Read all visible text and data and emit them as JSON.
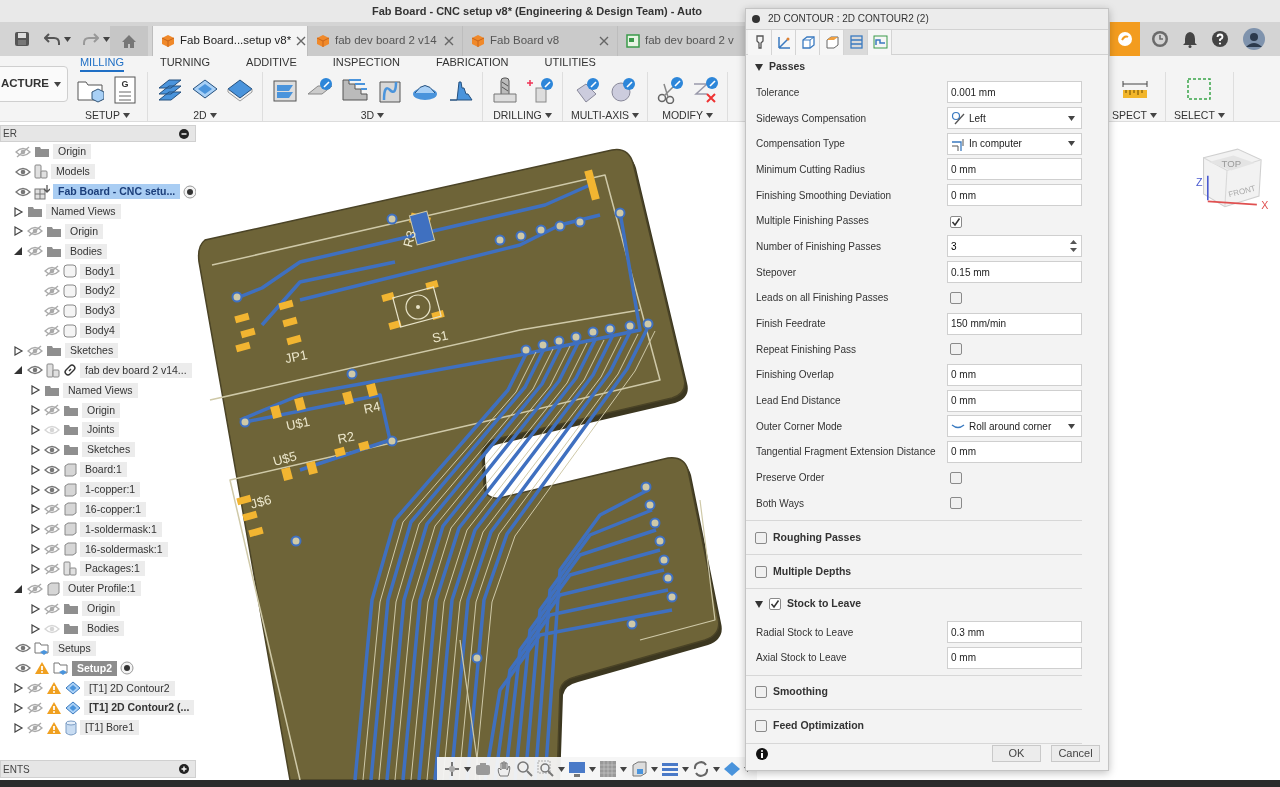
{
  "window": {
    "title": "Fab Board - CNC setup v8* (Engineering & Design Team) - Auto"
  },
  "document_tabs": [
    {
      "label": "Fab Board...setup v8*",
      "kind": "part",
      "selected": true
    },
    {
      "label": "fab dev board 2 v14",
      "kind": "part",
      "selected": false
    },
    {
      "label": "Fab Board v8",
      "kind": "part",
      "selected": false
    },
    {
      "label": "fab dev board 2 v",
      "kind": "drawing",
      "selected": false
    }
  ],
  "ribbon": {
    "workspace": "ACTURE",
    "tabs": [
      {
        "label": "MILLING",
        "selected": true
      },
      {
        "label": "TURNING",
        "selected": false
      },
      {
        "label": "ADDITIVE",
        "selected": false
      },
      {
        "label": "INSPECTION",
        "selected": false
      },
      {
        "label": "FABRICATION",
        "selected": false
      },
      {
        "label": "UTILITIES",
        "selected": false
      }
    ],
    "groups": [
      {
        "label": "SETUP",
        "icon_letter": "G"
      },
      {
        "label": "2D"
      },
      {
        "label": "3D"
      },
      {
        "label": "DRILLING"
      },
      {
        "label": "MULTI-AXIS"
      },
      {
        "label": "MODIFY"
      },
      {
        "label": "SPECT"
      },
      {
        "label": "SELECT"
      }
    ]
  },
  "browser": {
    "title": "ER",
    "tree": [
      {
        "label": "Origin",
        "visible": false,
        "kind": "folder",
        "selected": false
      },
      {
        "label": "Models",
        "visible": true,
        "kind": "component",
        "selected": false,
        "children": [
          {
            "label": "Fab Board - CNC setu...",
            "visible": true,
            "kind": "model",
            "selected": true,
            "bold": true,
            "radio": true,
            "children": [
              {
                "label": "Named Views",
                "kind": "folder",
                "expanded": false,
                "selected": false
              },
              {
                "label": "Origin",
                "visible": false,
                "kind": "folder",
                "expanded": false,
                "selected": false
              },
              {
                "label": "Bodies",
                "visible": false,
                "kind": "folder",
                "expanded": true,
                "selected": false,
                "children": [
                  {
                    "label": "Body1",
                    "visible": false,
                    "kind": "body",
                    "selected": false
                  },
                  {
                    "label": "Body2",
                    "visible": false,
                    "kind": "body",
                    "selected": false
                  },
                  {
                    "label": "Body3",
                    "visible": false,
                    "kind": "body",
                    "selected": false
                  },
                  {
                    "label": "Body4",
                    "visible": false,
                    "kind": "body",
                    "selected": false
                  }
                ]
              },
              {
                "label": "Sketches",
                "visible": false,
                "kind": "folder",
                "expanded": false,
                "selected": false
              },
              {
                "label": "fab dev board 2 v14...",
                "visible": true,
                "kind": "component",
                "link": true,
                "expanded": true,
                "selected": false,
                "children": [
                  {
                    "label": "Named Views",
                    "kind": "folder",
                    "expanded": false,
                    "selected": false
                  },
                  {
                    "label": "Origin",
                    "visible": false,
                    "kind": "folder",
                    "expanded": false,
                    "selected": false
                  },
                  {
                    "label": "Joints",
                    "visible": true,
                    "dimmed": true,
                    "kind": "folder",
                    "expanded": false,
                    "selected": false
                  },
                  {
                    "label": "Sketches",
                    "visible": true,
                    "kind": "folder",
                    "expanded": false,
                    "selected": false
                  },
                  {
                    "label": "Board:1",
                    "visible": true,
                    "kind": "solid",
                    "expanded": false,
                    "selected": false
                  },
                  {
                    "label": "1-copper:1",
                    "visible": true,
                    "kind": "solid",
                    "expanded": false,
                    "selected": false
                  },
                  {
                    "label": "16-copper:1",
                    "visible": false,
                    "kind": "solid",
                    "expanded": false,
                    "selected": false
                  },
                  {
                    "label": "1-soldermask:1",
                    "visible": false,
                    "kind": "solid",
                    "expanded": false,
                    "selected": false
                  },
                  {
                    "label": "16-soldermask:1",
                    "visible": false,
                    "kind": "solid",
                    "expanded": false,
                    "selected": false
                  },
                  {
                    "label": "Packages:1",
                    "visible": false,
                    "kind": "component",
                    "expanded": false,
                    "selected": false
                  }
                ]
              },
              {
                "label": "Outer Profile:1",
                "visible": false,
                "kind": "solid",
                "expanded": true,
                "selected": false,
                "children": [
                  {
                    "label": "Origin",
                    "visible": false,
                    "kind": "folder",
                    "expanded": false,
                    "selected": false
                  },
                  {
                    "label": "Bodies",
                    "visible": true,
                    "dimmed": true,
                    "kind": "folder",
                    "expanded": false,
                    "selected": false
                  }
                ]
              }
            ]
          }
        ]
      },
      {
        "label": "Setups",
        "visible": true,
        "kind": "setup",
        "selected": false,
        "children": [
          {
            "label": "Setup2",
            "visible": true,
            "warning": true,
            "kind": "setup",
            "active": true,
            "selected": false,
            "bold": true,
            "radio": true,
            "children": [
              {
                "label": "[T1] 2D Contour2",
                "visible": false,
                "warning": true,
                "kind": "contour",
                "expanded": false,
                "selected": false
              },
              {
                "label": "[T1] 2D Contour2 (...",
                "visible": false,
                "warning": true,
                "kind": "contour",
                "bold": true,
                "expanded": false,
                "selected": false
              },
              {
                "label": "[T1] Bore1",
                "visible": false,
                "warning": true,
                "kind": "bore",
                "expanded": false,
                "selected": false
              }
            ]
          }
        ]
      }
    ]
  },
  "comments": {
    "title": "ENTS"
  },
  "viewport": {
    "board_labels": [
      "R3",
      "JP1",
      "S1",
      "U$1",
      "R4",
      "R2",
      "U$5",
      "J$6"
    ],
    "view_cube": {
      "top": "TOP",
      "front": "FRONT",
      "axes": [
        "Z",
        "X"
      ]
    }
  },
  "dialog": {
    "title": "2D CONTOUR : 2D CONTOUR2 (2)",
    "tabs": [
      {
        "selected": false
      },
      {
        "selected": false
      },
      {
        "selected": false
      },
      {
        "selected": false
      },
      {
        "selected": true
      },
      {
        "selected": false
      }
    ],
    "sections": [
      {
        "title": "Passes",
        "expanded": true,
        "rows": [
          {
            "label": "Tolerance",
            "kind": "text",
            "value": "0.001 mm"
          },
          {
            "label": "Sideways Compensation",
            "kind": "dropdown",
            "value": "Left"
          },
          {
            "label": "Compensation Type",
            "kind": "dropdown",
            "value": "In computer"
          },
          {
            "label": "Minimum Cutting Radius",
            "kind": "text",
            "value": "0 mm"
          },
          {
            "label": "Finishing Smoothing Deviation",
            "kind": "text",
            "value": "0 mm"
          },
          {
            "label": "Multiple Finishing Passes",
            "kind": "checkbox",
            "checked": true
          },
          {
            "label": "Number of Finishing Passes",
            "kind": "spinner",
            "value": "3"
          },
          {
            "label": "Stepover",
            "kind": "text",
            "value": "0.15 mm"
          },
          {
            "label": "Leads on all Finishing Passes",
            "kind": "checkbox",
            "checked": false
          },
          {
            "label": "Finish Feedrate",
            "kind": "text",
            "value": "150 mm/min"
          },
          {
            "label": "Repeat Finishing Pass",
            "kind": "checkbox",
            "checked": false
          },
          {
            "label": "Finishing Overlap",
            "kind": "text",
            "value": "0 mm"
          },
          {
            "label": "Lead End Distance",
            "kind": "text",
            "value": "0 mm"
          },
          {
            "label": "Outer Corner Mode",
            "kind": "dropdown",
            "value": "Roll around corner"
          },
          {
            "label": "Tangential Fragment Extension Distance",
            "kind": "text",
            "value": "0 mm"
          },
          {
            "label": "Preserve Order",
            "kind": "checkbox",
            "checked": false
          },
          {
            "label": "Both Ways",
            "kind": "checkbox",
            "checked": false
          }
        ]
      },
      {
        "title": "Roughing Passes",
        "checked": false
      },
      {
        "title": "Multiple Depths",
        "checked": false
      },
      {
        "title": "Stock to Leave",
        "expanded": true,
        "checked": true,
        "rows": [
          {
            "label": "Radial Stock to Leave",
            "kind": "text",
            "value": "0.3 mm"
          },
          {
            "label": "Axial Stock to Leave",
            "kind": "text",
            "value": "0 mm"
          }
        ]
      },
      {
        "title": "Smoothing",
        "checked": false
      },
      {
        "title": "Feed Optimization",
        "checked": false
      }
    ],
    "buttons": [
      "OK",
      "Cancel"
    ]
  }
}
